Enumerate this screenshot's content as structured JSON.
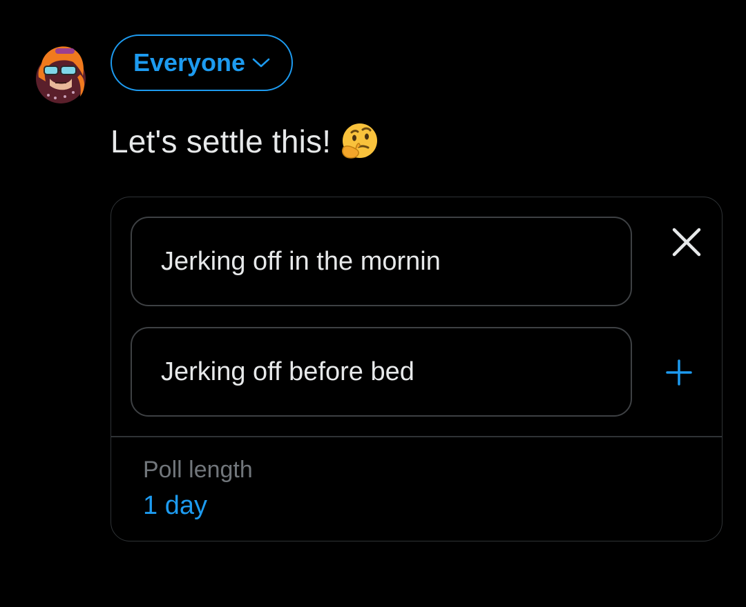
{
  "composer": {
    "audience_label": "Everyone",
    "text": "Let's settle this!",
    "emoji": "thinking-face"
  },
  "poll": {
    "choices": [
      {
        "value": "Jerking off in the mornin",
        "action_icon": "close-icon"
      },
      {
        "value": "Jerking off before bed",
        "action_icon": "plus-icon"
      }
    ],
    "length_label": "Poll length",
    "length_value": "1 day"
  },
  "colors": {
    "background": "#000000",
    "accent": "#1d9bf0",
    "text": "#e7e9ea",
    "muted": "#71767b",
    "border": "#2f3336"
  }
}
